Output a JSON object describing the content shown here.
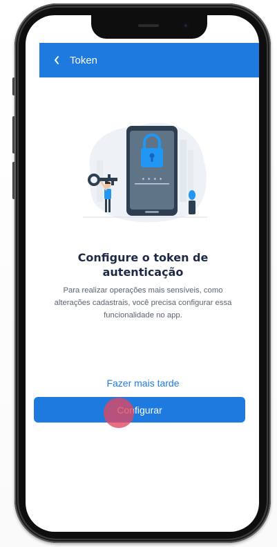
{
  "header": {
    "title": "Token",
    "back_icon": "chevron-left-icon"
  },
  "illustration": {
    "icon": "phone-lock-key-illustration",
    "password_mask": "* * * *"
  },
  "main": {
    "title_line1": "Configure o token de",
    "title_line2": "autenticação",
    "description_line1": "Para realizar operações mais sensíveis, como",
    "description_line2": "alterações cadastrais, você precisa configurar essa",
    "description_line3": "funcionalidade no app."
  },
  "actions": {
    "later_label": "Fazer mais tarde",
    "configure_label": "Configurar"
  },
  "colors": {
    "primary": "#1f7ae0",
    "title": "#1d2a47",
    "body_text": "#5a6370",
    "tap_indicator": "#e2465f"
  }
}
